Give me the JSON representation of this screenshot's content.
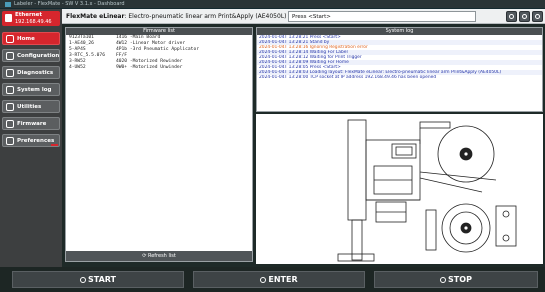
{
  "titlebar": {
    "text": "Labeler - FlexMate - SW V 3.1.x - Dashboard"
  },
  "sidebar": {
    "ethernet": {
      "line1": "Ethernet",
      "line2": "192.168.49.46"
    },
    "items": [
      {
        "label": "Home",
        "icon": "home-icon",
        "active": true
      },
      {
        "label": "Configuration",
        "icon": "wrench-icon",
        "active": false
      },
      {
        "label": "Diagnostics",
        "icon": "stethoscope-icon",
        "active": false
      },
      {
        "label": "System log",
        "icon": "log-icon",
        "active": false
      },
      {
        "label": "Utilities",
        "icon": "utilities-icon",
        "active": false
      },
      {
        "label": "Firmware",
        "icon": "firmware-icon",
        "active": false
      },
      {
        "label": "Preferences",
        "icon": "preferences-icon",
        "active": false
      }
    ]
  },
  "header": {
    "machine_name": "FlexMate eLinear",
    "machine_desc": ": Electro-pneumatic linear arm Print&Apply (AE4050L)",
    "status": "Press <Start>"
  },
  "firmware": {
    "title": "Firmware list",
    "rows": [
      {
        "id": "9123Ta101",
        "desc": "1416 -Main Board"
      },
      {
        "id": "1-AE40_26",
        "desc": "4W12 -Linear Motor driver"
      },
      {
        "id": "5-AP4S",
        "desc": "4P1b -3rd Pneumatic Applicator"
      },
      {
        "id": "3-RTC_5.5.076",
        "desc": "FF/F"
      },
      {
        "id": "3-RW52",
        "desc": "4020 -Motorized Rewinder"
      },
      {
        "id": "4-UW52",
        "desc": "9W0+ -Motorized Unwinder"
      }
    ],
    "refresh_label": "Refresh list"
  },
  "systemlog": {
    "title": "System log",
    "rows": [
      {
        "text": "2024-01-04T 13:28:21 Press <Start>",
        "style": "blue"
      },
      {
        "text": "2024-01-04T 13:28:21 Stand by",
        "style": "blue"
      },
      {
        "text": "2024-01-04T 13:28:16 Ignoring Registration error",
        "style": "orange"
      },
      {
        "text": "2024-01-04T 13:28:14 Waiting For Label",
        "style": "blue"
      },
      {
        "text": "2024-01-04T 13:28:12 Waiting for Print Trigger",
        "style": "blue"
      },
      {
        "text": "2024-01-04T 13:28:09 Waiting For Home",
        "style": "blue"
      },
      {
        "text": "2024-01-04T 13:28:05 Press <Start>",
        "style": "blue"
      },
      {
        "text": "2024-01-04T 13:28:03 Loading layout: FlexMate eLinear: Electro-pneumatic linear arm Print&Apply (AE4050L)",
        "style": "blue"
      },
      {
        "text": "2024-01-04T 13:28:00 TCP socket at IP address 192.168.49.46 has been opened",
        "style": "blue"
      }
    ]
  },
  "bottom": {
    "start": "START",
    "enter": "ENTER",
    "stop": "STOP"
  },
  "colors": {
    "accent": "#d6262d",
    "log_blue": "#2434a8",
    "log_orange": "#e0641e"
  }
}
